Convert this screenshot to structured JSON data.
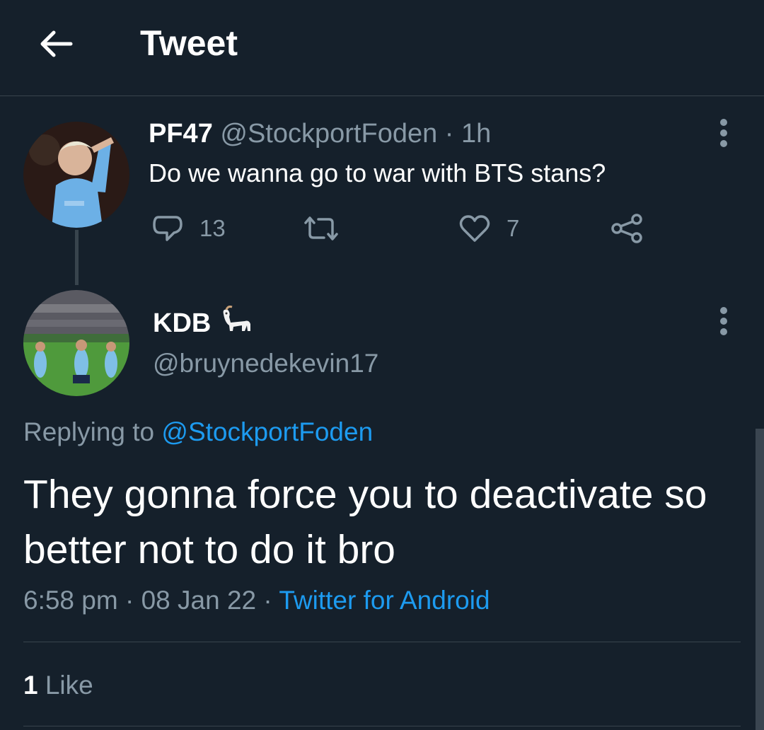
{
  "header": {
    "title": "Tweet"
  },
  "parent_tweet": {
    "display_name": "PF47",
    "handle": "@StockportFoden",
    "time": "· 1h",
    "text": "Do we wanna go to war with BTS stans?",
    "reply_count": "13",
    "retweet_count": "",
    "like_count": "7"
  },
  "reply_tweet": {
    "display_name": "KDB",
    "handle": "@bruynedekevin17",
    "replying_prefix": "Replying to",
    "replying_to": "@StockportFoden",
    "text": "They gonna force you to deactivate so better not to do it bro",
    "time": "6:58 pm",
    "date": "· 08 Jan 22 ·",
    "source": "Twitter for Android",
    "likes_count": "1",
    "likes_label": "Like"
  },
  "colors": {
    "background": "#15202b",
    "muted": "#8899a6",
    "link": "#1d9bf0",
    "divider": "#38444d"
  }
}
